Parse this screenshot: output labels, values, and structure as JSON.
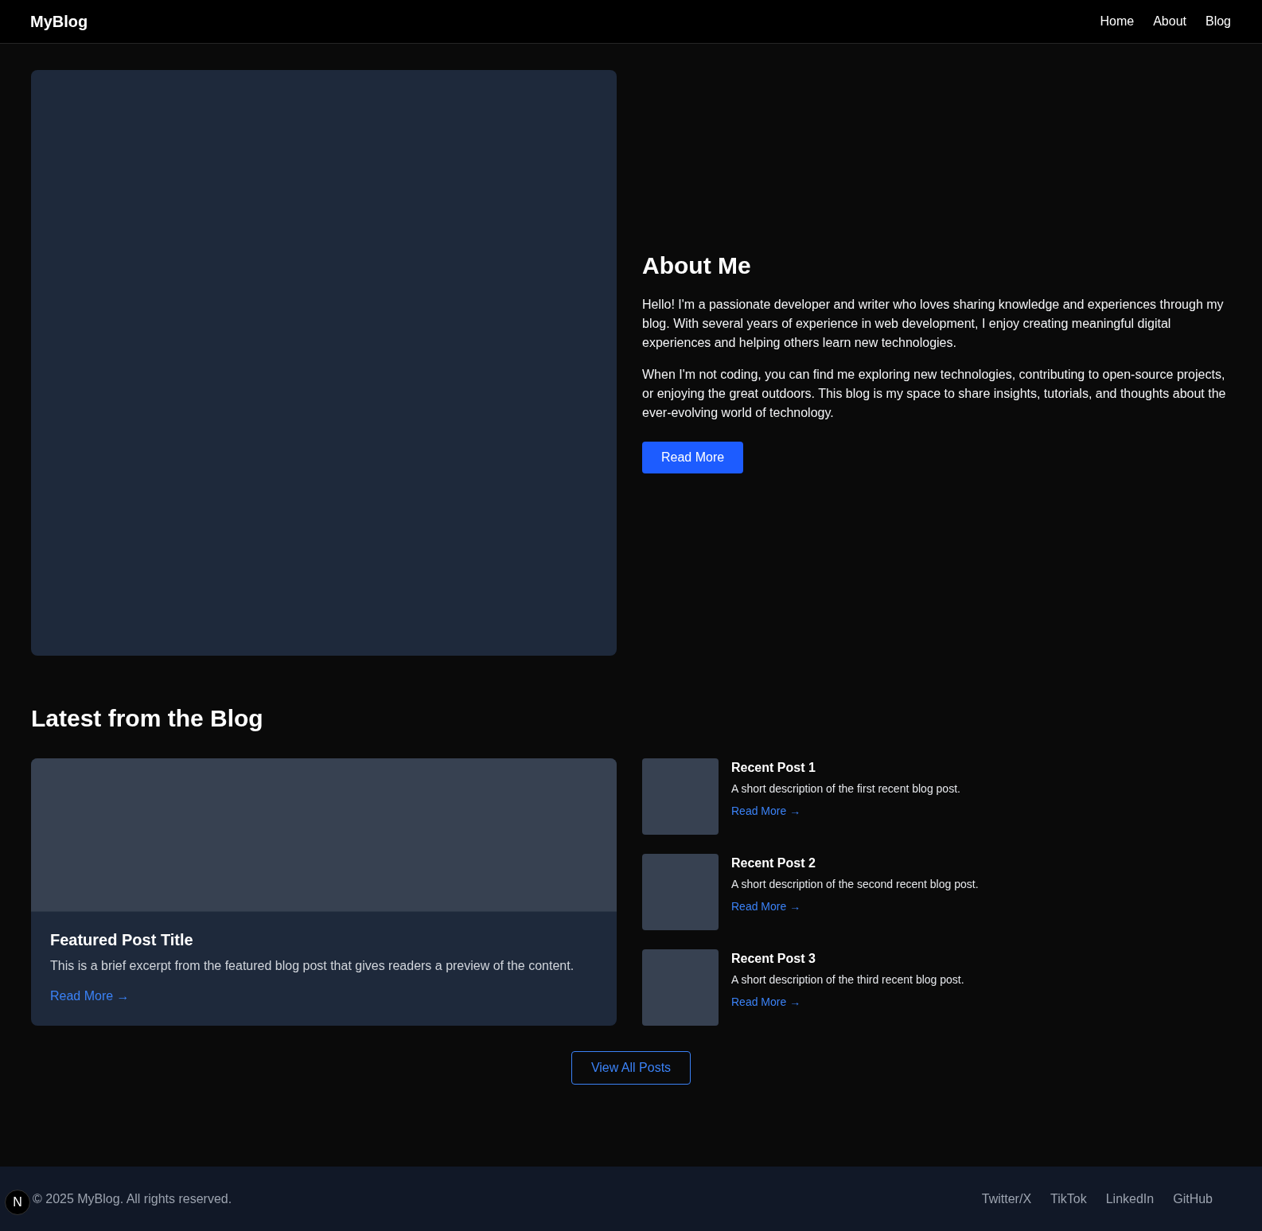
{
  "nav": {
    "logo": "MyBlog",
    "links": [
      "Home",
      "About",
      "Blog"
    ]
  },
  "about": {
    "title": "About Me",
    "paragraphs": [
      "Hello! I'm a passionate developer and writer who loves sharing knowledge and experiences through my blog. With several years of experience in web development, I enjoy creating meaningful digital experiences and helping others learn new technologies.",
      "When I'm not coding, you can find me exploring new technologies, contributing to open-source projects, or enjoying the great outdoors. This blog is my space to share insights, tutorials, and thoughts about the ever-evolving world of technology."
    ],
    "button": "Read More"
  },
  "blog": {
    "title": "Latest from the Blog",
    "featured": {
      "title": "Featured Post Title",
      "excerpt": "This is a brief excerpt from the featured blog post that gives readers a preview of the content.",
      "link": "Read More →"
    },
    "recent": [
      {
        "title": "Recent Post 1",
        "description": "A short description of the first recent blog post.",
        "link": "Read More →"
      },
      {
        "title": "Recent Post 2",
        "description": "A short description of the second recent blog post.",
        "link": "Read More →"
      },
      {
        "title": "Recent Post 3",
        "description": "A short description of the third recent blog post.",
        "link": "Read More →"
      }
    ],
    "view_all": "View All Posts"
  },
  "footer": {
    "copyright": "© 2025 MyBlog. All rights reserved.",
    "links": [
      "Twitter/X",
      "TikTok",
      "LinkedIn",
      "GitHub"
    ],
    "dev_badge": "N"
  }
}
